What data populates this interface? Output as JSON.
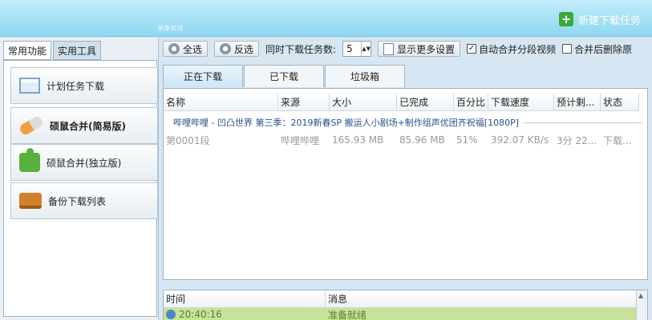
{
  "app": {
    "watermark": "单身资讯",
    "new_task": "新建下载任务"
  },
  "left": {
    "tabs": [
      "常用功能",
      "实用工具"
    ],
    "items": [
      {
        "label": "计划任务下载",
        "icon": "calendar-icon"
      },
      {
        "label": "硕鼠合并(简易版)",
        "icon": "pill-icon"
      },
      {
        "label": "硕鼠合并(独立版)",
        "icon": "puzzle-icon"
      },
      {
        "label": "备份下载列表",
        "icon": "wallet-icon"
      }
    ]
  },
  "toolbar": {
    "select_all": "全选",
    "invert": "反选",
    "concurrent_label": "同时下载任务数:",
    "concurrent_value": "5",
    "more_settings": "显示更多设置",
    "auto_merge": "自动合并分段视频",
    "auto_merge_checked": true,
    "delete_after_merge": "合并后删除原",
    "delete_after_merge_checked": false
  },
  "tabs": [
    "正在下载",
    "已下载",
    "垃圾箱"
  ],
  "table": {
    "columns": [
      "名称",
      "来源",
      "大小",
      "已完成",
      "百分比",
      "下载速度",
      "预计剩...",
      "状态"
    ],
    "group_title": "哔哩哔哩 - 凹凸世界 第三季：2019新春SP 搬运人小剧场+制作组声优团齐祝福[1080P]",
    "rows": [
      [
        "第0001段",
        "哔哩哔哩",
        "165.93 MB",
        "85.96 MB",
        "51%",
        "392.07 KB/s",
        "3分 22...",
        "下载..."
      ]
    ]
  },
  "log": {
    "columns": [
      "时间",
      "消息"
    ],
    "rows": [
      [
        "20:40:16",
        "准备就绪"
      ]
    ]
  }
}
